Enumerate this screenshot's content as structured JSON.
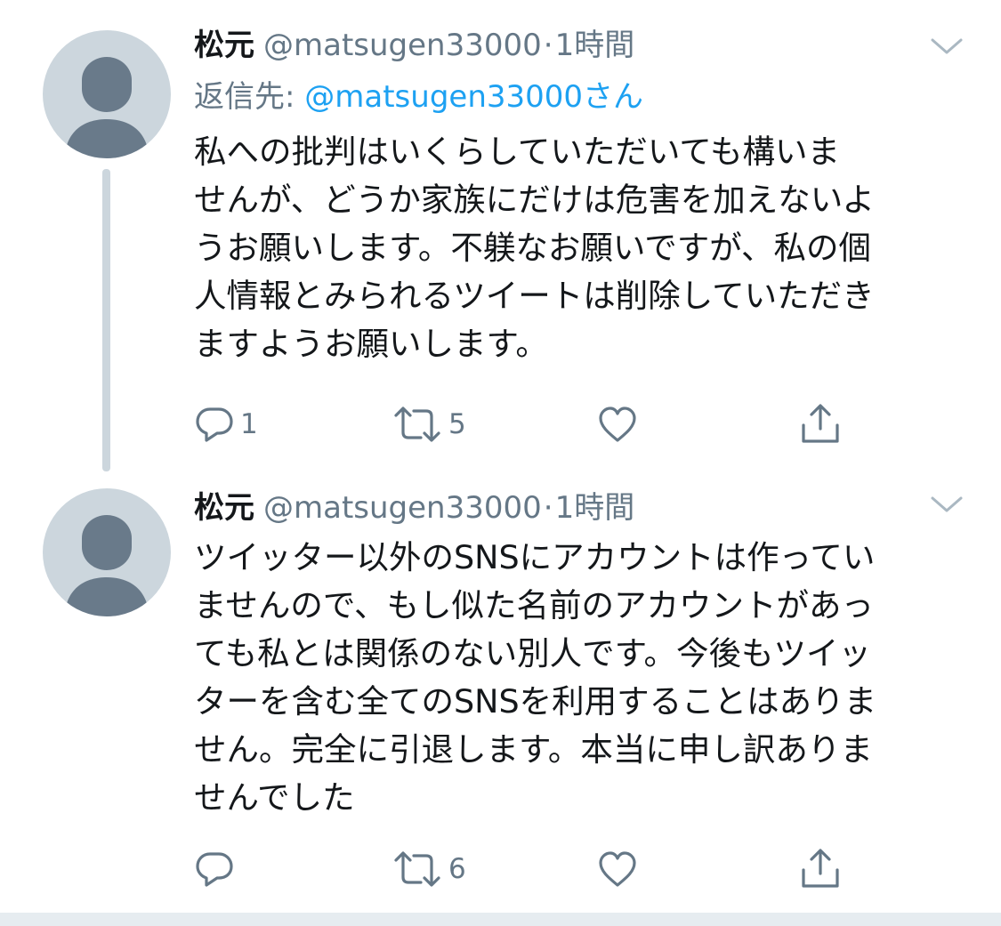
{
  "tweets": [
    {
      "author": {
        "name": "松元",
        "handle": "@matsugen33000",
        "separator": "·",
        "time": "1時間"
      },
      "reply_to": {
        "prefix": "返信先: ",
        "mention": "@matsugen33000さん"
      },
      "lines": [
        "私への批判はいくらしていただいても構いま",
        "せんが、どうか家族にだけは危害を加えないよ",
        "うお願いします。不躾なお願いですが、私の個",
        "人情報とみられるツイートは削除していただき",
        "ますようお願いします。"
      ],
      "stats": {
        "replies": "1",
        "retweets": "5",
        "likes": ""
      }
    },
    {
      "author": {
        "name": "松元",
        "handle": "@matsugen33000",
        "separator": "·",
        "time": "1時間"
      },
      "lines": [
        "ツイッター以外のSNSにアカウントは作ってい",
        "ませんので、もし似た名前のアカウントがあっ",
        "ても私とは関係のない別人です。今後もツイッ",
        "ターを含む全てのSNSを利用することはありま",
        "せん。完全に引退します。本当に申し訳ありま",
        "せんでした"
      ],
      "stats": {
        "replies": "",
        "retweets": "6",
        "likes": ""
      }
    }
  ],
  "icons": {
    "avatar": "default-profile-icon",
    "menu": "chevron-down-icon",
    "reply": "reply-bubble-icon",
    "retweet": "retweet-icon",
    "like": "heart-icon",
    "share": "share-icon"
  },
  "colors": {
    "text": "#14171a",
    "secondary": "#657786",
    "link": "#1da1f2",
    "avatar_bg": "#ccd6dd",
    "avatar_fg": "#697a8a",
    "divider": "#e6ecf0"
  }
}
